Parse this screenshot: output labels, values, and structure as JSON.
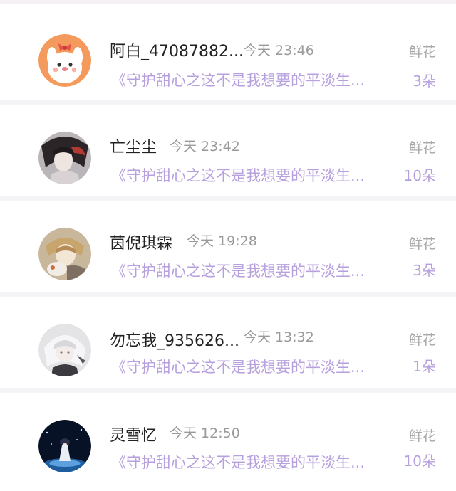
{
  "records": [
    {
      "name": "阿白_47087882...",
      "time": "今天 23:46",
      "book": "《守护甜心之这不是我想要的平淡生...",
      "gift_type": "鲜花",
      "gift_count": "3朵",
      "avatar": "orange-bunny-avatar"
    },
    {
      "name": "亡尘尘",
      "time": "今天 23:42",
      "book": "《守护甜心之这不是我想要的平淡生...",
      "gift_type": "鲜花",
      "gift_count": "10朵",
      "avatar": "dark-hair-character-avatar"
    },
    {
      "name": "茵倪琪霖",
      "time": "今天 19:28",
      "book": "《守护甜心之这不是我想要的平淡生...",
      "gift_type": "鲜花",
      "gift_count": "3朵",
      "avatar": "boy-with-cat-avatar"
    },
    {
      "name": "勿忘我_935626...",
      "time": "今天 13:32",
      "book": "《守护甜心之这不是我想要的平淡生...",
      "gift_type": "鲜花",
      "gift_count": "1朵",
      "avatar": "white-hair-character-avatar"
    },
    {
      "name": "灵雪忆",
      "time": "今天 12:50",
      "book": "《守护甜心之这不是我想要的平淡生...",
      "gift_type": "鲜花",
      "gift_count": "10朵",
      "avatar": "night-sky-figure-avatar"
    }
  ],
  "colors": {
    "accent_purple": "#b7a0de",
    "name_text": "#222222",
    "muted_text": "#9a9a9a"
  }
}
